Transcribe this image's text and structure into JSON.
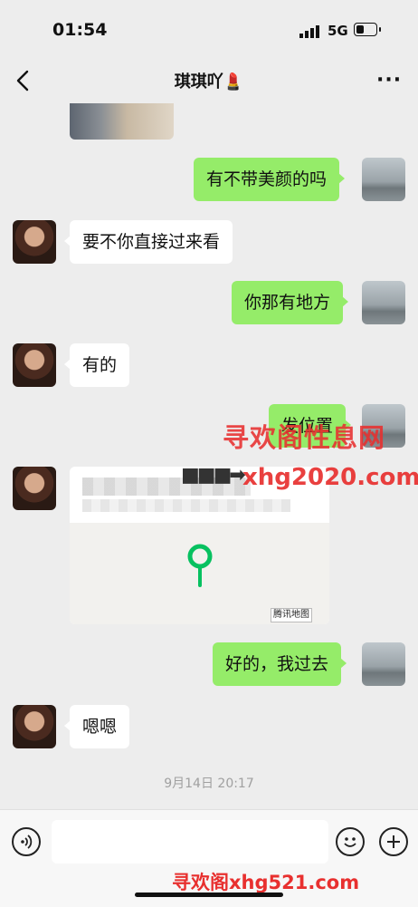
{
  "status_bar": {
    "time": "01:54",
    "network": "5G"
  },
  "header": {
    "title": "琪琪吖💄",
    "more": "···"
  },
  "messages": [
    {
      "side": "out",
      "text": "有不带美颜的吗"
    },
    {
      "side": "in",
      "text": "要不你直接过来看"
    },
    {
      "side": "out",
      "text": "你那有地方"
    },
    {
      "side": "in",
      "text": "有的"
    },
    {
      "side": "out",
      "text": "发位置"
    },
    {
      "side": "in",
      "type": "location",
      "map_provider": "腾讯地图"
    },
    {
      "side": "out",
      "text": "好的，我过去"
    },
    {
      "side": "in",
      "text": "嗯嗯"
    }
  ],
  "timestamp": "9月14日 20:17",
  "input": {
    "placeholder": ""
  },
  "watermarks": {
    "wm1": "寻欢阁性息网",
    "wm2": "xhg2020.com",
    "wm3": "寻欢阁xhg521.com",
    "arrow": "■■■➡"
  },
  "colors": {
    "background": "#ededed",
    "outgoing_bubble": "#95ec69",
    "incoming_bubble": "#ffffff",
    "watermark": "#e8302f"
  },
  "icons": {
    "back": "chevron-left-icon",
    "more": "more-dots-icon",
    "voice": "voice-icon",
    "emoji": "emoji-icon",
    "plus": "plus-icon",
    "pin": "map-pin-icon"
  }
}
